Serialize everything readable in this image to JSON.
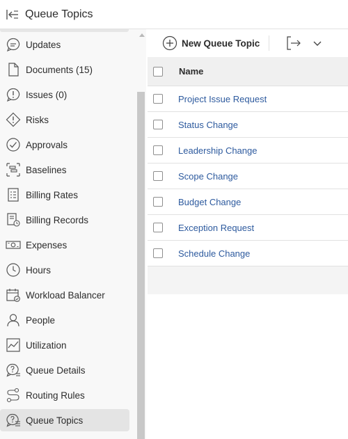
{
  "header": {
    "title": "Queue Topics",
    "back_icon": "collapse-left-icon"
  },
  "sidebar": {
    "items": [
      {
        "label": "Updates",
        "icon": "speech-bubble-icon"
      },
      {
        "label": "Documents (15)",
        "icon": "document-icon"
      },
      {
        "label": "Issues (0)",
        "icon": "alert-bubble-icon"
      },
      {
        "label": "Risks",
        "icon": "risk-diamond-icon"
      },
      {
        "label": "Approvals",
        "icon": "check-circle-icon"
      },
      {
        "label": "Baselines",
        "icon": "baseline-icon"
      },
      {
        "label": "Billing Rates",
        "icon": "billing-rates-icon"
      },
      {
        "label": "Billing Records",
        "icon": "billing-records-icon"
      },
      {
        "label": "Expenses",
        "icon": "money-icon"
      },
      {
        "label": "Hours",
        "icon": "clock-icon"
      },
      {
        "label": "Workload Balancer",
        "icon": "calendar-check-icon"
      },
      {
        "label": "People",
        "icon": "person-icon"
      },
      {
        "label": "Utilization",
        "icon": "line-chart-icon"
      },
      {
        "label": "Queue Details",
        "icon": "queue-details-icon"
      },
      {
        "label": "Routing Rules",
        "icon": "routing-icon"
      },
      {
        "label": "Queue Topics",
        "icon": "queue-topics-icon",
        "active": true
      }
    ]
  },
  "toolbar": {
    "new_label": "New Queue Topic"
  },
  "table": {
    "column_header": "Name",
    "rows": [
      "Project Issue Request",
      "Status Change",
      "Leadership Change",
      "Scope Change",
      "Budget Change",
      "Exception Request",
      "Schedule Change"
    ]
  },
  "colors": {
    "link": "#2d5a9e",
    "active_bg": "#e4e4e4",
    "sidebar_bg": "#f8f8f8"
  }
}
